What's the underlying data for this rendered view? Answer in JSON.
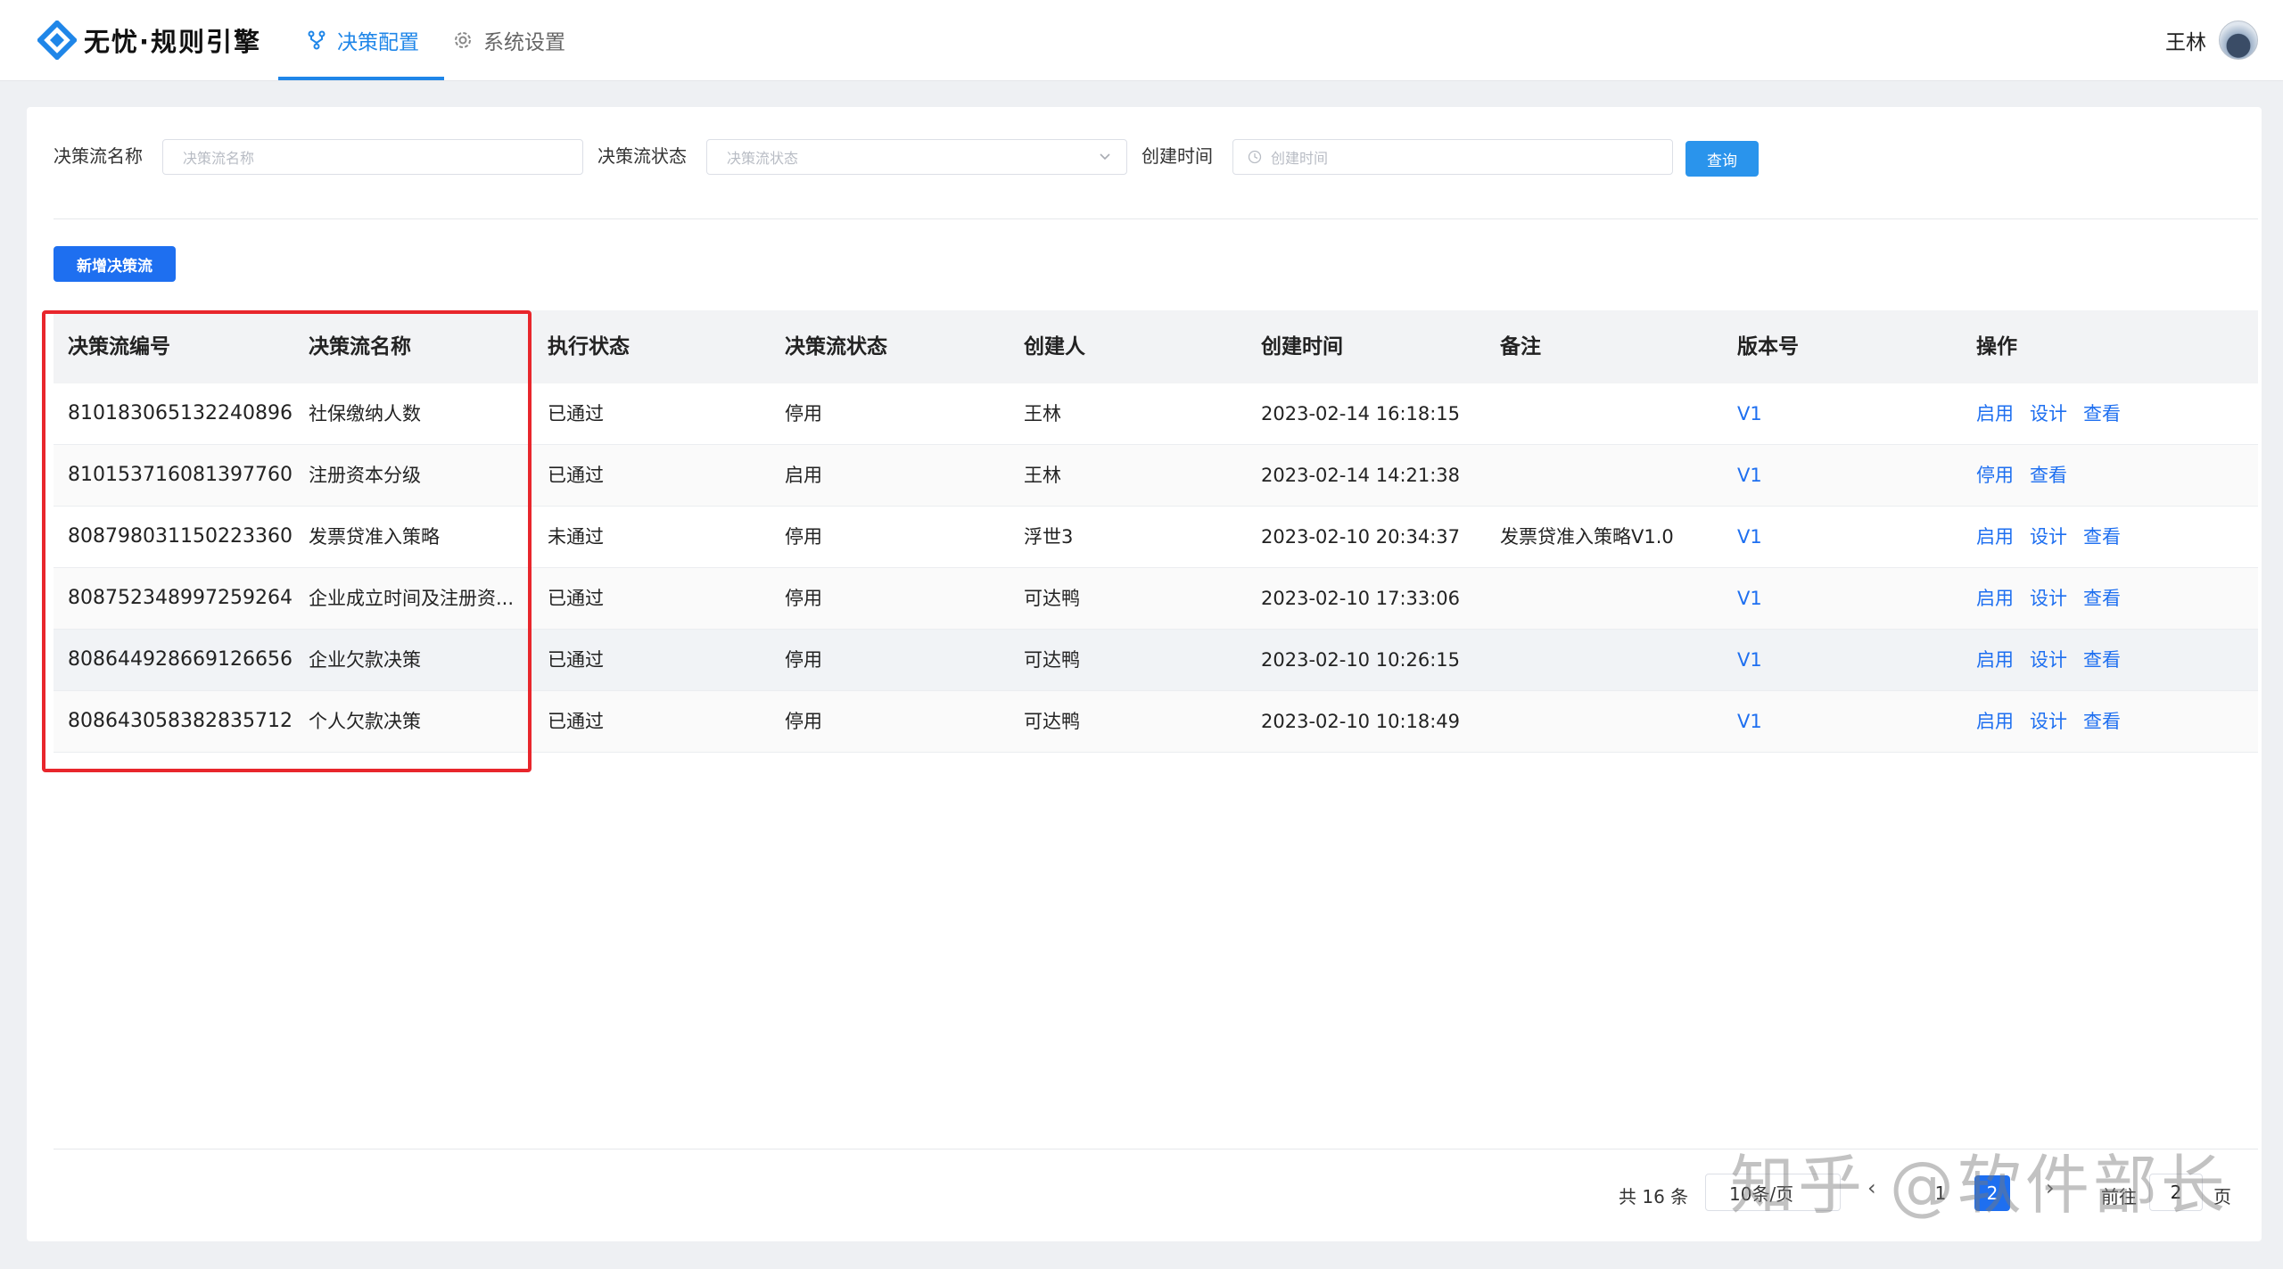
{
  "app": {
    "title": "无忧·规则引擎"
  },
  "nav": {
    "tabs": [
      {
        "label": "决策配置",
        "active": true
      },
      {
        "label": "系统设置",
        "active": false
      }
    ]
  },
  "user": {
    "name": "王林"
  },
  "filters": {
    "name_label": "决策流名称",
    "name_placeholder": "决策流名称",
    "status_label": "决策流状态",
    "status_placeholder": "决策流状态",
    "time_label": "创建时间",
    "time_placeholder": "创建时间",
    "query_button": "查询"
  },
  "actions": {
    "add_button": "新增决策流"
  },
  "table": {
    "columns": [
      "决策流编号",
      "决策流名称",
      "执行状态",
      "决策流状态",
      "创建人",
      "创建时间",
      "备注",
      "版本号",
      "操作"
    ],
    "rows": [
      {
        "id": "810183065132240896",
        "name": "社保缴纳人数",
        "exec_status": "已通过",
        "flow_status": "停用",
        "creator": "王林",
        "created": "2023-02-14 16:18:15",
        "remark": "",
        "version": "V1",
        "ops": [
          "启用",
          "设计",
          "查看"
        ]
      },
      {
        "id": "810153716081397760",
        "name": "注册资本分级",
        "exec_status": "已通过",
        "flow_status": "启用",
        "creator": "王林",
        "created": "2023-02-14 14:21:38",
        "remark": "",
        "version": "V1",
        "ops": [
          "停用",
          "查看"
        ]
      },
      {
        "id": "808798031150223360",
        "name": "发票贷准入策略",
        "exec_status": "未通过",
        "flow_status": "停用",
        "creator": "浮世3",
        "created": "2023-02-10 20:34:37",
        "remark": "发票贷准入策略V1.0",
        "version": "V1",
        "ops": [
          "启用",
          "设计",
          "查看"
        ]
      },
      {
        "id": "808752348997259264",
        "name": "企业成立时间及注册资...",
        "exec_status": "已通过",
        "flow_status": "停用",
        "creator": "可达鸭",
        "created": "2023-02-10 17:33:06",
        "remark": "",
        "version": "V1",
        "ops": [
          "启用",
          "设计",
          "查看"
        ]
      },
      {
        "id": "808644928669126656",
        "name": "企业欠款决策",
        "exec_status": "已通过",
        "flow_status": "停用",
        "creator": "可达鸭",
        "created": "2023-02-10 10:26:15",
        "remark": "",
        "version": "V1",
        "ops": [
          "启用",
          "设计",
          "查看"
        ]
      },
      {
        "id": "808643058382835712",
        "name": "个人欠款决策",
        "exec_status": "已通过",
        "flow_status": "停用",
        "creator": "可达鸭",
        "created": "2023-02-10 10:18:49",
        "remark": "",
        "version": "V1",
        "ops": [
          "启用",
          "设计",
          "查看"
        ]
      }
    ]
  },
  "pagination": {
    "total": "共 16 条",
    "page_size": "10条/页",
    "prev": "‹",
    "pages": [
      "1",
      "2"
    ],
    "current": "2",
    "next": "›",
    "goto_label": "前往",
    "goto_value": "2",
    "goto_suffix": "页"
  },
  "watermark": "知乎 @软件部长",
  "colors": {
    "primary": "#1e6ff0",
    "accent_tab": "#1f86e8",
    "highlight_border": "#e8262c"
  }
}
